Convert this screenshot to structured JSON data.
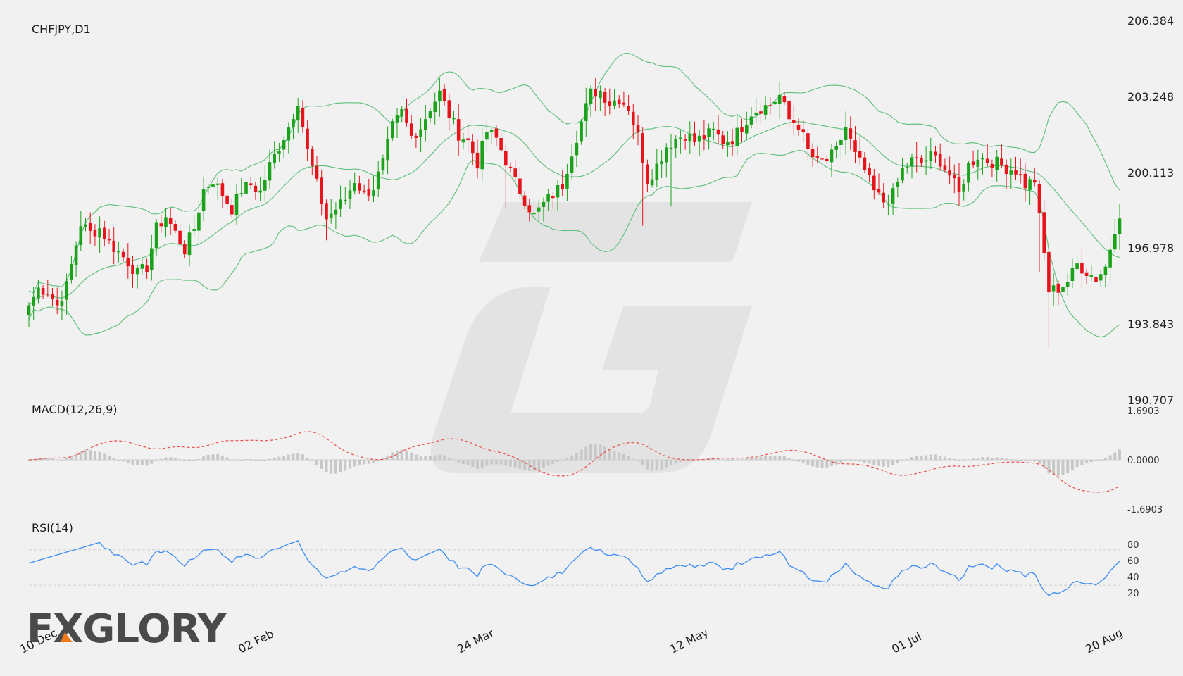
{
  "logo": {
    "text": "FXGLORY"
  },
  "chart_data": {
    "type": "candlestick",
    "title": "CHFJPY,D1",
    "price_axis": {
      "ticks": [
        "206.384",
        "203.248",
        "200.113",
        "196.978",
        "193.843",
        "190.707"
      ],
      "range": [
        190.707,
        206.384
      ]
    },
    "date_labels": [
      "10 Dec",
      "02 Feb",
      "24 Mar",
      "12 May",
      "01 Jul",
      "20 Aug"
    ],
    "bollinger": {
      "period": 20,
      "deviation": 2
    },
    "candles": {
      "start_date": "2024-12-10",
      "anchors": [
        [
          0,
          194.6
        ],
        [
          2,
          195.3
        ],
        [
          4,
          195.2
        ],
        [
          6,
          194.6
        ],
        [
          8,
          195.4
        ],
        [
          11,
          198.0
        ],
        [
          13,
          197.6
        ],
        [
          15,
          197.8
        ],
        [
          17,
          197.2
        ],
        [
          19,
          196.8
        ],
        [
          21,
          196.4
        ],
        [
          23,
          195.9
        ],
        [
          25,
          196.2
        ],
        [
          27,
          197.8
        ],
        [
          29,
          198.3
        ],
        [
          31,
          197.6
        ],
        [
          33,
          196.9
        ],
        [
          35,
          197.8
        ],
        [
          37,
          199.4
        ],
        [
          39,
          199.8
        ],
        [
          41,
          199.2
        ],
        [
          43,
          198.6
        ],
        [
          45,
          199.4
        ],
        [
          47,
          199.6
        ],
        [
          49,
          199.3
        ],
        [
          51,
          200.4
        ],
        [
          53,
          201.2
        ],
        [
          55,
          202.0
        ],
        [
          57,
          203.1
        ],
        [
          59,
          201.0
        ],
        [
          61,
          199.6
        ],
        [
          63,
          198.2
        ],
        [
          65,
          198.6
        ],
        [
          67,
          199.0
        ],
        [
          69,
          199.8
        ],
        [
          71,
          199.2
        ],
        [
          73,
          199.5
        ],
        [
          75,
          200.5
        ],
        [
          77,
          202.0
        ],
        [
          79,
          202.6
        ],
        [
          81,
          201.6
        ],
        [
          83,
          202.0
        ],
        [
          85,
          202.8
        ],
        [
          87,
          203.4
        ],
        [
          89,
          202.5
        ],
        [
          91,
          201.7
        ],
        [
          93,
          201.4
        ],
        [
          95,
          200.5
        ],
        [
          97,
          201.8
        ],
        [
          99,
          201.5
        ],
        [
          101,
          200.6
        ],
        [
          103,
          199.7
        ],
        [
          105,
          199.0
        ],
        [
          107,
          198.3
        ],
        [
          109,
          198.8
        ],
        [
          111,
          199.2
        ],
        [
          113,
          199.6
        ],
        [
          115,
          201.0
        ],
        [
          117,
          202.2
        ],
        [
          119,
          203.4
        ],
        [
          121,
          203.5
        ],
        [
          123,
          203.0
        ],
        [
          125,
          203.2
        ],
        [
          127,
          202.8
        ],
        [
          129,
          201.6
        ],
        [
          131,
          199.8
        ],
        [
          133,
          200.4
        ],
        [
          135,
          201.2
        ],
        [
          137,
          201.5
        ],
        [
          139,
          201.7
        ],
        [
          141,
          201.4
        ],
        [
          143,
          201.6
        ],
        [
          145,
          201.8
        ],
        [
          147,
          201.4
        ],
        [
          149,
          201.5
        ],
        [
          151,
          202.0
        ],
        [
          153,
          202.6
        ],
        [
          155,
          202.8
        ],
        [
          157,
          202.9
        ],
        [
          159,
          203.3
        ],
        [
          161,
          202.3
        ],
        [
          163,
          202.1
        ],
        [
          165,
          201.0
        ],
        [
          167,
          200.5
        ],
        [
          169,
          200.6
        ],
        [
          171,
          201.0
        ],
        [
          173,
          202.0
        ],
        [
          175,
          200.8
        ],
        [
          177,
          200.2
        ],
        [
          179,
          199.3
        ],
        [
          181,
          198.9
        ],
        [
          183,
          199.2
        ],
        [
          185,
          200.2
        ],
        [
          187,
          200.6
        ],
        [
          189,
          200.5
        ],
        [
          191,
          200.8
        ],
        [
          193,
          200.6
        ],
        [
          195,
          200.0
        ],
        [
          197,
          199.2
        ],
        [
          199,
          200.4
        ],
        [
          201,
          200.8
        ],
        [
          203,
          200.6
        ],
        [
          205,
          200.5
        ],
        [
          207,
          200.3
        ],
        [
          209,
          200.2
        ],
        [
          211,
          199.6
        ],
        [
          213,
          199.8
        ],
        [
          214,
          198.2
        ],
        [
          216,
          195.2
        ],
        [
          218,
          195.3
        ],
        [
          220,
          195.6
        ],
        [
          222,
          196.3
        ],
        [
          224,
          196.0
        ],
        [
          226,
          195.7
        ],
        [
          228,
          196.2
        ],
        [
          230,
          197.8
        ],
        [
          231,
          198.2
        ]
      ]
    },
    "macd": {
      "label": "MACD(12,26,9)",
      "fast": 12,
      "slow": 26,
      "signal": 9,
      "ticks": [
        "1.6903",
        "0.0000",
        "-1.6903"
      ],
      "range": [
        -1.6903,
        1.6903
      ]
    },
    "rsi": {
      "label": "RSI(14)",
      "period": 14,
      "ticks": [
        "80",
        "60",
        "40",
        "20"
      ],
      "levels": [
        70,
        30
      ],
      "range": [
        15,
        85
      ]
    },
    "colors": {
      "up": "#1aa31a",
      "down": "#e8141c",
      "bands": "#5cbf7a",
      "signal": "#e8504a",
      "histogram": "#c8c8c8",
      "rsi": "#3c8cf0",
      "logo_accent": "#f07a1a"
    }
  }
}
